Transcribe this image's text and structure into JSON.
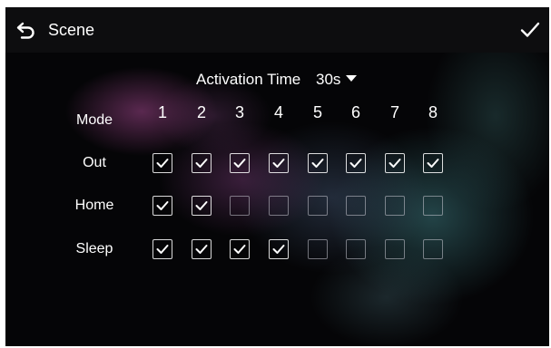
{
  "header": {
    "title": "Scene",
    "back_icon": "back-arrow-icon",
    "confirm_icon": "checkmark-icon"
  },
  "activation": {
    "label": "Activation Time",
    "value": "30s"
  },
  "grid": {
    "mode_header": "Mode",
    "columns": [
      "1",
      "2",
      "3",
      "4",
      "5",
      "6",
      "7",
      "8"
    ],
    "rows": [
      {
        "label": "Out",
        "checked": [
          true,
          true,
          true,
          true,
          true,
          true,
          true,
          true
        ]
      },
      {
        "label": "Home",
        "checked": [
          true,
          true,
          false,
          false,
          false,
          false,
          false,
          false
        ]
      },
      {
        "label": "Sleep",
        "checked": [
          true,
          true,
          true,
          true,
          false,
          false,
          false,
          false
        ]
      }
    ]
  },
  "colors": {
    "header_bg": "#0d0d0f",
    "text": "#ffffff",
    "checkbox_border": "#ffffff"
  }
}
